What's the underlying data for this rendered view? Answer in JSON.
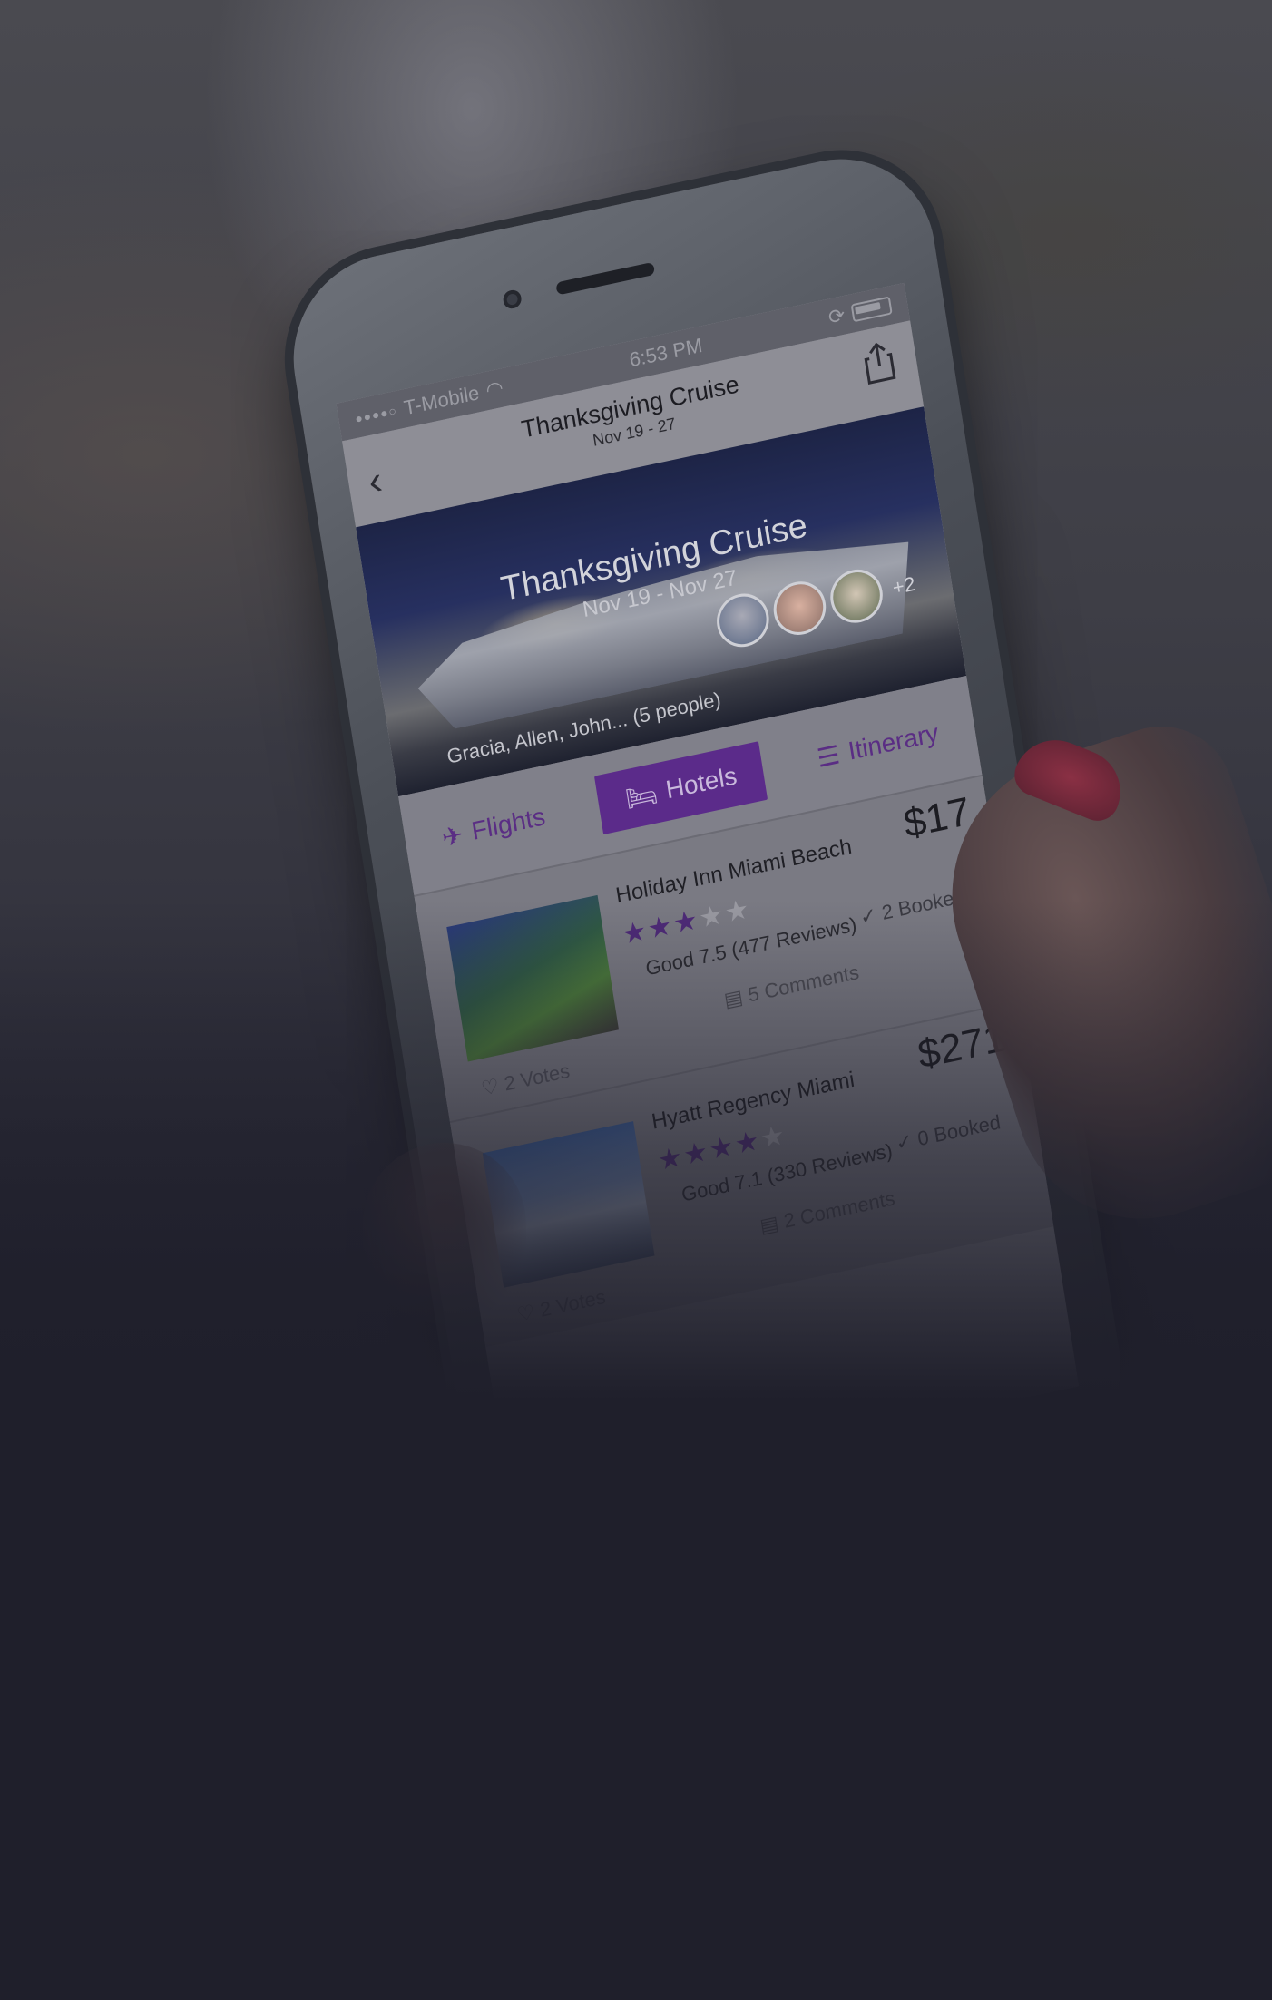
{
  "status_bar": {
    "carrier": "T-Mobile",
    "time": "6:53 PM"
  },
  "nav": {
    "title": "Thanksgiving Cruise",
    "subtitle": "Nov 19 - 27"
  },
  "hero": {
    "title": "Thanksgiving Cruise",
    "dates": "Nov 19 - Nov 27",
    "people": "Gracia, Allen, John... (5 people)",
    "extra_count": "+2"
  },
  "tabs": [
    {
      "label": "Flights",
      "icon": "plane-icon",
      "active": false
    },
    {
      "label": "Hotels",
      "icon": "bed-icon",
      "active": true
    },
    {
      "label": "Itinerary",
      "icon": "list-icon",
      "active": false
    }
  ],
  "hotels": [
    {
      "name": "Holiday Inn Miami Beach",
      "price": "$17",
      "stars": 3,
      "rating": "Good 7.5 (477 Reviews)",
      "booked": "2 Booked",
      "comments": "5 Comments",
      "votes": "2 Votes"
    },
    {
      "name": "Hyatt Regency Miami",
      "price": "$271",
      "stars": 4,
      "rating": "Good 7.1 (330 Reviews)",
      "booked": "0 Booked",
      "comments": "2 Comments",
      "votes": "2 Votes"
    }
  ],
  "colors": {
    "accent": "#5b2b8a",
    "background": "#1f1f2b"
  }
}
